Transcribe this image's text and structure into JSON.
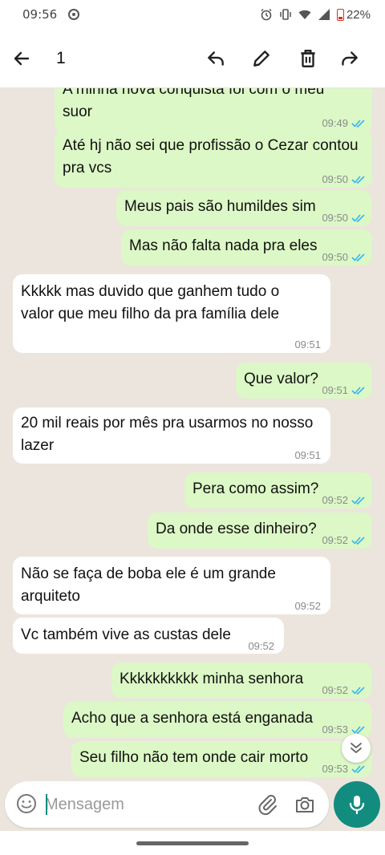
{
  "status_bar": {
    "time": "09:56",
    "battery": "22%"
  },
  "header": {
    "selected_count": "1"
  },
  "messages": [
    {
      "dir": "out",
      "lines": [
        "A minha nova conquista foi com o meu",
        "suor"
      ],
      "time": "09:49",
      "read": true
    },
    {
      "dir": "out",
      "lines": [
        "Até hj não sei que profissão o Cezar contou",
        "pra vcs"
      ],
      "time": "09:50",
      "read": true
    },
    {
      "dir": "out",
      "lines": [
        "Meus pais são humildes sim"
      ],
      "time": "09:50",
      "read": true
    },
    {
      "dir": "out",
      "lines": [
        "Mas não falta nada pra eles"
      ],
      "time": "09:50",
      "read": true
    },
    {
      "dir": "in",
      "lines": [
        "Kkkkk mas duvido que ganhem tudo o",
        "valor que meu filho da pra família dele"
      ],
      "time": "09:51"
    },
    {
      "dir": "out",
      "lines": [
        "Que valor?"
      ],
      "time": "09:51",
      "read": true
    },
    {
      "dir": "in",
      "lines": [
        "20 mil reais por mês pra usarmos no nosso",
        "lazer"
      ],
      "time": "09:51"
    },
    {
      "dir": "out",
      "lines": [
        "Pera como assim?"
      ],
      "time": "09:52",
      "read": true
    },
    {
      "dir": "out",
      "lines": [
        "Da onde esse dinheiro?"
      ],
      "time": "09:52",
      "read": true
    },
    {
      "dir": "in",
      "lines": [
        "Não se faça de boba ele é um grande",
        "arquiteto"
      ],
      "time": "09:52"
    },
    {
      "dir": "in",
      "lines": [
        "Vc também vive as custas dele"
      ],
      "time": "09:52"
    },
    {
      "dir": "out",
      "lines": [
        "Kkkkkkkkkk minha senhora"
      ],
      "time": "09:52",
      "read": true
    },
    {
      "dir": "out",
      "lines": [
        "Acho que a senhora está enganada"
      ],
      "time": "09:53",
      "read": true
    },
    {
      "dir": "out",
      "lines": [
        "Seu filho não tem onde cair morto"
      ],
      "time": "09:53",
      "read": true
    }
  ],
  "composer": {
    "placeholder": "Mensagem"
  },
  "colors": {
    "outgoing_bubble": "#dcf8c6",
    "incoming_bubble": "#ffffff",
    "accent": "#128c7e",
    "read_ticks": "#34b7f1"
  }
}
